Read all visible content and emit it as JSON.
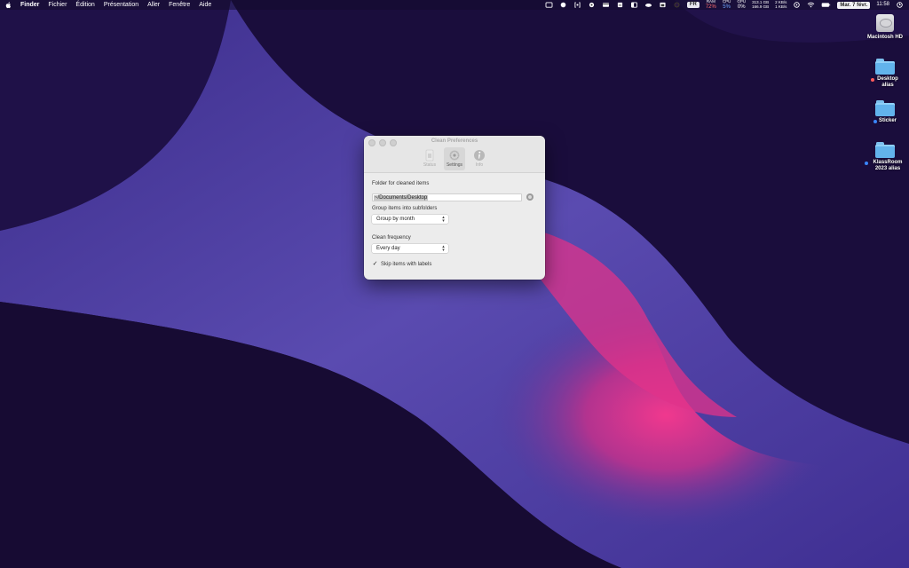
{
  "menubar": {
    "app_name": "Finder",
    "menus": [
      "Fichier",
      "Édition",
      "Présentation",
      "Aller",
      "Fenêtre",
      "Aide"
    ],
    "stats": {
      "ram_label": "RAM",
      "ram_value": "72%",
      "cpu_label": "CPU",
      "cpu_value": "5%",
      "gpu_label": "GPU",
      "gpu_value": "0%",
      "disk_top": "313.1 GB",
      "disk_bottom": "166.9 GB",
      "net_up": "2 KB/s",
      "net_down": "1 KB/s"
    },
    "input_source": "FR",
    "date": "Mar. 7 févr.",
    "time": "11:58"
  },
  "desktop": {
    "items": [
      {
        "label": "Macintosh HD",
        "type": "disk",
        "dot": ""
      },
      {
        "label": "Desktop alias",
        "type": "folder",
        "dot": "#ff5c5c"
      },
      {
        "label": "Sticker",
        "type": "folder",
        "dot": "#3a86ff"
      },
      {
        "label": "KlassRoom 2023 alias",
        "type": "folder",
        "dot": "#3a86ff"
      }
    ]
  },
  "window": {
    "title": "Clean Preferences",
    "tabs": [
      {
        "label": "Status",
        "icon": "status-icon",
        "active": false
      },
      {
        "label": "Settings",
        "icon": "gear-icon",
        "active": true
      },
      {
        "label": "Info",
        "icon": "info-icon",
        "active": false
      }
    ],
    "folder_label": "Folder for cleaned items",
    "folder_path": "~/Documents/Desktop",
    "group_label": "Group items into subfolders",
    "group_value": "Group by month",
    "frequency_label": "Clean frequency",
    "frequency_value": "Every day",
    "skip_label": "Skip items with labels",
    "skip_checked": true
  },
  "colors": {
    "desktop_bg": "#1b0f3f",
    "wallpaper_purple": "#4a3a9e",
    "wallpaper_pink": "#e0338a",
    "folder_blue": "#62b3ec"
  }
}
